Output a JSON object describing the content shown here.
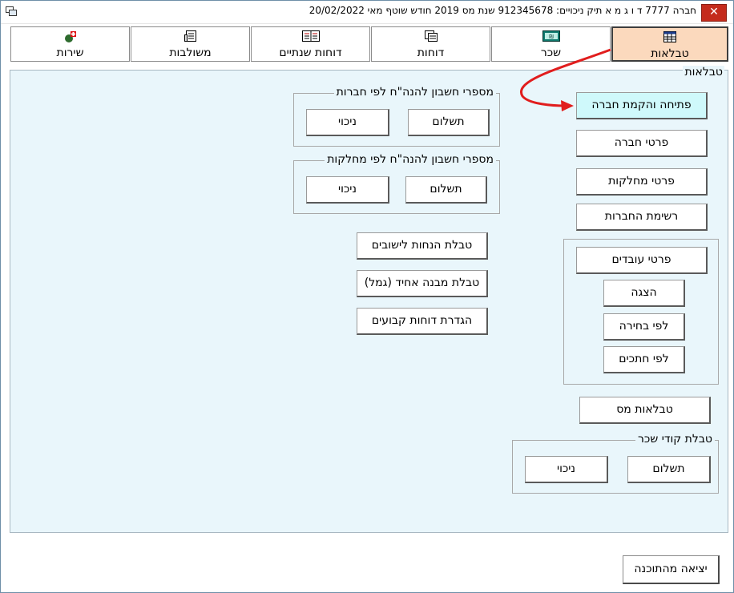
{
  "window": {
    "title": "חברה 7777 ד ו ג מ א תיק ניכויים: 912345678   שנת מס 2019   חודש שוטף מאי   20/02/2022",
    "close_symbol": "✕"
  },
  "tabs": [
    {
      "label": "טבלאות",
      "icon": "table-icon",
      "active": true
    },
    {
      "label": "שכר",
      "icon": "payroll-icon",
      "active": false
    },
    {
      "label": "דוחות",
      "icon": "reports-icon",
      "active": false
    },
    {
      "label": "דוחות שנתיים",
      "icon": "annual-reports-icon",
      "active": false
    },
    {
      "label": "משולבות",
      "icon": "combined-icon",
      "active": false
    },
    {
      "label": "שירות",
      "icon": "service-icon",
      "active": false
    }
  ],
  "panel": {
    "title": "טבלאות",
    "buttons": {
      "open_company": "פתיחה והקמת חברה",
      "company_details": "פרטי חברה",
      "department_details": "פרטי מחלקות",
      "company_list": "רשימת החברות",
      "tax_tables": "טבלאות מס",
      "settlement_discounts": "טבלת הנחות לישובים",
      "uniform_structure": "טבלת מבנה אחיד (גמל)",
      "fixed_reports": "הגדרת דוחות קבועים"
    },
    "employees_group": {
      "employee_details": "פרטי עובדים",
      "display": "הצגה",
      "by_selection": "לפי בחירה",
      "by_cuts": "לפי חתכים"
    },
    "accounts_by_company": {
      "label": "מספרי חשבון להנה\"ח לפי חברות",
      "payment": "תשלום",
      "deduction": "ניכוי"
    },
    "accounts_by_department": {
      "label": "מספרי חשבון להנה\"ח לפי מחלקות",
      "payment": "תשלום",
      "deduction": "ניכוי"
    },
    "salary_codes": {
      "label": "טבלת קודי שכר",
      "payment": "תשלום",
      "deduction": "ניכוי"
    }
  },
  "footer": {
    "exit_label": "יציאה מהתוכנה"
  },
  "colors": {
    "active_tab": "#fbd9bd",
    "panel_bg": "#e9f6fb",
    "highlight_button": "#cff9fb",
    "annotation_arrow": "#e11d1d",
    "close_button": "#c42b1c"
  }
}
